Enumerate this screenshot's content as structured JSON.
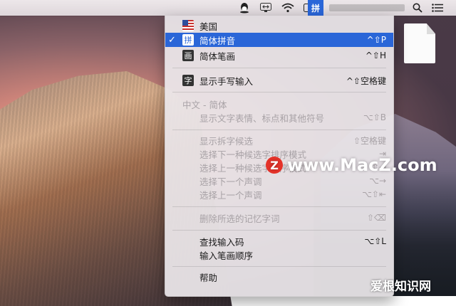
{
  "menubar": {
    "qq_icon": "qq-penguin-icon",
    "teamviewer_icon": "teamviewer-icon",
    "wifi_icon": "wifi-icon",
    "battery_icon": "battery-charging-icon",
    "ime_label": "拼",
    "search_icon": "spotlight-search-icon",
    "menu_icon": "notification-list-icon"
  },
  "menu": {
    "items": [
      {
        "label": "美国",
        "shortcut": "",
        "icon": "us-flag-icon"
      },
      {
        "label": "简体拼音",
        "shortcut": "^⇧P",
        "icon_text": "拼",
        "checked": "✓"
      },
      {
        "label": "简体笔画",
        "shortcut": "^⇧H",
        "icon_text": "画"
      },
      {
        "label": "显示手写输入",
        "shortcut": "^⇧空格键",
        "icon_text": "字"
      },
      {
        "label": "中文 - 简体",
        "shortcut": ""
      },
      {
        "label": "显示文字表情、标点和其他符号",
        "shortcut": "⌥⇧B"
      },
      {
        "label": "显示拆字候选",
        "shortcut": "⇧空格键"
      },
      {
        "label": "选择下一种候选字排序模式",
        "shortcut": "⇥"
      },
      {
        "label": "选择上一种候选字排序模式",
        "shortcut": "⇧⇥"
      },
      {
        "label": "选择下一个声调",
        "shortcut": "⌥→"
      },
      {
        "label": "选择上一个声调",
        "shortcut": "⌥⇧⇤"
      },
      {
        "label": "删除所选的记忆字词",
        "shortcut": "⇧⌫"
      },
      {
        "label": "查找输入码",
        "shortcut": "⌥⇧L"
      },
      {
        "label": "输入笔画顺序",
        "shortcut": ""
      },
      {
        "label": "帮助",
        "shortcut": ""
      }
    ]
  },
  "watermark": {
    "badge": "Z",
    "text": "www.MacZ.com",
    "corner_text": "爱根知识网"
  },
  "colors": {
    "accent": "#2a66d8",
    "disabled_text": "#a8a2a6"
  }
}
